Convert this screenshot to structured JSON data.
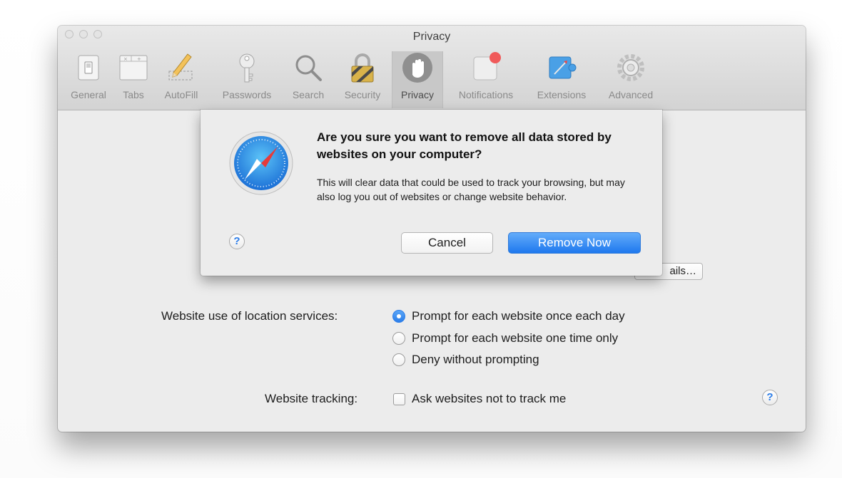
{
  "window": {
    "title": "Privacy"
  },
  "toolbar": {
    "items": [
      {
        "label": "General",
        "icon": "general-switch-icon"
      },
      {
        "label": "Tabs",
        "icon": "tabs-icon"
      },
      {
        "label": "AutoFill",
        "icon": "pencil-icon"
      },
      {
        "label": "Passwords",
        "icon": "key-icon"
      },
      {
        "label": "Search",
        "icon": "magnifier-icon"
      },
      {
        "label": "Security",
        "icon": "padlock-icon"
      },
      {
        "label": "Privacy",
        "icon": "hand-icon"
      },
      {
        "label": "Notifications",
        "icon": "notification-badge-icon"
      },
      {
        "label": "Extensions",
        "icon": "puzzle-icon"
      },
      {
        "label": "Advanced",
        "icon": "gear-icon"
      }
    ],
    "selected": "Privacy"
  },
  "content": {
    "details_button_label": "ails…",
    "location_label": "Website use of location services:",
    "location_options": [
      "Prompt for each website once each day",
      "Prompt for each website one time only",
      "Deny without prompting"
    ],
    "location_selected_index": 0,
    "tracking_label": "Website tracking:",
    "tracking_checkbox_label": "Ask websites not to track me",
    "tracking_checked": false,
    "help_glyph": "?"
  },
  "dialog": {
    "title": "Are you sure you want to remove all data stored by websites on your computer?",
    "message": "This will clear data that could be used to track your browsing, but may also log you out of websites or change website behavior.",
    "cancel_label": "Cancel",
    "confirm_label": "Remove Now",
    "help_glyph": "?",
    "icon": "safari-compass-icon"
  },
  "colors": {
    "accent": "#2b7de9",
    "window_bg": "#ececec",
    "toolbar_selected_bg": "#c8c8c8",
    "notification_dot": "#f05a5a"
  }
}
